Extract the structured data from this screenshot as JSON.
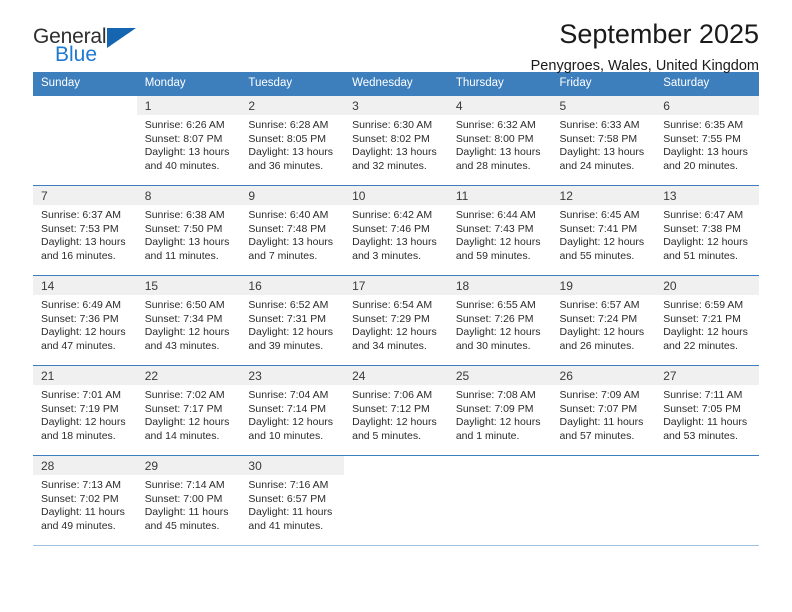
{
  "brand": {
    "name_top": "General",
    "name_bottom": "Blue",
    "color_primary": "#1c7ad1",
    "color_triangle": "#1565b0",
    "color_text": "#2e2e2e"
  },
  "header": {
    "title": "September 2025",
    "subtitle": "Penygroes, Wales, United Kingdom"
  },
  "theme": {
    "header_bg": "#3d7ebd",
    "header_text": "#ffffff",
    "daynum_band_bg": "#f0f0f0",
    "cell_bg": "#ffffff",
    "grid_line": "#3d7ebd"
  },
  "calendar": {
    "weekday_headers": [
      "Sunday",
      "Monday",
      "Tuesday",
      "Wednesday",
      "Thursday",
      "Friday",
      "Saturday"
    ],
    "weeks": [
      [
        {
          "day": "",
          "lines": []
        },
        {
          "day": "1",
          "lines": [
            "Sunrise: 6:26 AM",
            "Sunset: 8:07 PM",
            "Daylight: 13 hours",
            "and 40 minutes."
          ]
        },
        {
          "day": "2",
          "lines": [
            "Sunrise: 6:28 AM",
            "Sunset: 8:05 PM",
            "Daylight: 13 hours",
            "and 36 minutes."
          ]
        },
        {
          "day": "3",
          "lines": [
            "Sunrise: 6:30 AM",
            "Sunset: 8:02 PM",
            "Daylight: 13 hours",
            "and 32 minutes."
          ]
        },
        {
          "day": "4",
          "lines": [
            "Sunrise: 6:32 AM",
            "Sunset: 8:00 PM",
            "Daylight: 13 hours",
            "and 28 minutes."
          ]
        },
        {
          "day": "5",
          "lines": [
            "Sunrise: 6:33 AM",
            "Sunset: 7:58 PM",
            "Daylight: 13 hours",
            "and 24 minutes."
          ]
        },
        {
          "day": "6",
          "lines": [
            "Sunrise: 6:35 AM",
            "Sunset: 7:55 PM",
            "Daylight: 13 hours",
            "and 20 minutes."
          ]
        }
      ],
      [
        {
          "day": "7",
          "lines": [
            "Sunrise: 6:37 AM",
            "Sunset: 7:53 PM",
            "Daylight: 13 hours",
            "and 16 minutes."
          ]
        },
        {
          "day": "8",
          "lines": [
            "Sunrise: 6:38 AM",
            "Sunset: 7:50 PM",
            "Daylight: 13 hours",
            "and 11 minutes."
          ]
        },
        {
          "day": "9",
          "lines": [
            "Sunrise: 6:40 AM",
            "Sunset: 7:48 PM",
            "Daylight: 13 hours",
            "and 7 minutes."
          ]
        },
        {
          "day": "10",
          "lines": [
            "Sunrise: 6:42 AM",
            "Sunset: 7:46 PM",
            "Daylight: 13 hours",
            "and 3 minutes."
          ]
        },
        {
          "day": "11",
          "lines": [
            "Sunrise: 6:44 AM",
            "Sunset: 7:43 PM",
            "Daylight: 12 hours",
            "and 59 minutes."
          ]
        },
        {
          "day": "12",
          "lines": [
            "Sunrise: 6:45 AM",
            "Sunset: 7:41 PM",
            "Daylight: 12 hours",
            "and 55 minutes."
          ]
        },
        {
          "day": "13",
          "lines": [
            "Sunrise: 6:47 AM",
            "Sunset: 7:38 PM",
            "Daylight: 12 hours",
            "and 51 minutes."
          ]
        }
      ],
      [
        {
          "day": "14",
          "lines": [
            "Sunrise: 6:49 AM",
            "Sunset: 7:36 PM",
            "Daylight: 12 hours",
            "and 47 minutes."
          ]
        },
        {
          "day": "15",
          "lines": [
            "Sunrise: 6:50 AM",
            "Sunset: 7:34 PM",
            "Daylight: 12 hours",
            "and 43 minutes."
          ]
        },
        {
          "day": "16",
          "lines": [
            "Sunrise: 6:52 AM",
            "Sunset: 7:31 PM",
            "Daylight: 12 hours",
            "and 39 minutes."
          ]
        },
        {
          "day": "17",
          "lines": [
            "Sunrise: 6:54 AM",
            "Sunset: 7:29 PM",
            "Daylight: 12 hours",
            "and 34 minutes."
          ]
        },
        {
          "day": "18",
          "lines": [
            "Sunrise: 6:55 AM",
            "Sunset: 7:26 PM",
            "Daylight: 12 hours",
            "and 30 minutes."
          ]
        },
        {
          "day": "19",
          "lines": [
            "Sunrise: 6:57 AM",
            "Sunset: 7:24 PM",
            "Daylight: 12 hours",
            "and 26 minutes."
          ]
        },
        {
          "day": "20",
          "lines": [
            "Sunrise: 6:59 AM",
            "Sunset: 7:21 PM",
            "Daylight: 12 hours",
            "and 22 minutes."
          ]
        }
      ],
      [
        {
          "day": "21",
          "lines": [
            "Sunrise: 7:01 AM",
            "Sunset: 7:19 PM",
            "Daylight: 12 hours",
            "and 18 minutes."
          ]
        },
        {
          "day": "22",
          "lines": [
            "Sunrise: 7:02 AM",
            "Sunset: 7:17 PM",
            "Daylight: 12 hours",
            "and 14 minutes."
          ]
        },
        {
          "day": "23",
          "lines": [
            "Sunrise: 7:04 AM",
            "Sunset: 7:14 PM",
            "Daylight: 12 hours",
            "and 10 minutes."
          ]
        },
        {
          "day": "24",
          "lines": [
            "Sunrise: 7:06 AM",
            "Sunset: 7:12 PM",
            "Daylight: 12 hours",
            "and 5 minutes."
          ]
        },
        {
          "day": "25",
          "lines": [
            "Sunrise: 7:08 AM",
            "Sunset: 7:09 PM",
            "Daylight: 12 hours",
            "and 1 minute."
          ]
        },
        {
          "day": "26",
          "lines": [
            "Sunrise: 7:09 AM",
            "Sunset: 7:07 PM",
            "Daylight: 11 hours",
            "and 57 minutes."
          ]
        },
        {
          "day": "27",
          "lines": [
            "Sunrise: 7:11 AM",
            "Sunset: 7:05 PM",
            "Daylight: 11 hours",
            "and 53 minutes."
          ]
        }
      ],
      [
        {
          "day": "28",
          "lines": [
            "Sunrise: 7:13 AM",
            "Sunset: 7:02 PM",
            "Daylight: 11 hours",
            "and 49 minutes."
          ]
        },
        {
          "day": "29",
          "lines": [
            "Sunrise: 7:14 AM",
            "Sunset: 7:00 PM",
            "Daylight: 11 hours",
            "and 45 minutes."
          ]
        },
        {
          "day": "30",
          "lines": [
            "Sunrise: 7:16 AM",
            "Sunset: 6:57 PM",
            "Daylight: 11 hours",
            "and 41 minutes."
          ]
        },
        {
          "day": "",
          "lines": []
        },
        {
          "day": "",
          "lines": []
        },
        {
          "day": "",
          "lines": []
        },
        {
          "day": "",
          "lines": []
        }
      ]
    ]
  }
}
